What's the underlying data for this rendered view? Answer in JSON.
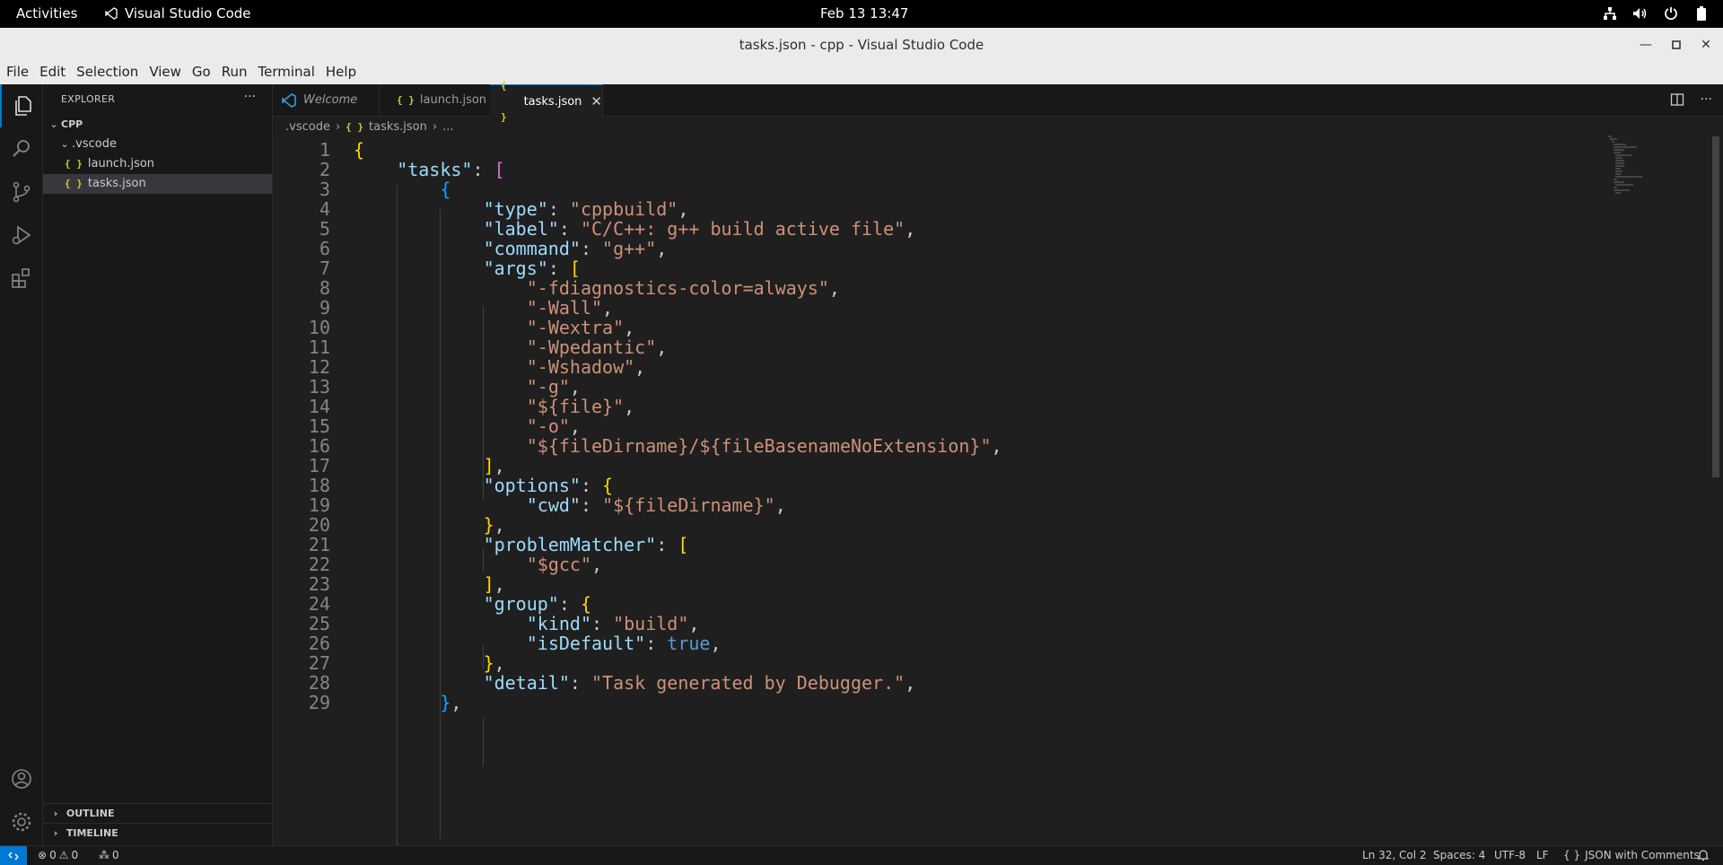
{
  "topbar": {
    "activities": "Activities",
    "app_name": "Visual Studio Code",
    "clock": "Feb 13  13:47"
  },
  "window": {
    "title": "tasks.json - cpp - Visual Studio Code"
  },
  "menu": [
    "File",
    "Edit",
    "Selection",
    "View",
    "Go",
    "Run",
    "Terminal",
    "Help"
  ],
  "sidebar": {
    "header": "EXPLORER",
    "root": "CPP",
    "folder": ".vscode",
    "files": [
      "launch.json",
      "tasks.json"
    ],
    "sections": [
      "OUTLINE",
      "TIMELINE"
    ]
  },
  "tabs": [
    {
      "label": "Welcome"
    },
    {
      "label": "launch.json"
    },
    {
      "label": "tasks.json"
    }
  ],
  "breadcrumb": [
    ".vscode",
    "tasks.json",
    "..."
  ],
  "editor": {
    "line_numbers": [
      "1",
      "2",
      "3",
      "4",
      "5",
      "6",
      "7",
      "8",
      "9",
      "10",
      "11",
      "12",
      "13",
      "14",
      "15",
      "16",
      "17",
      "18",
      "19",
      "20",
      "21",
      "22",
      "23",
      "24",
      "25",
      "26",
      "27",
      "28",
      "29"
    ],
    "lines": [
      "{",
      "    \"tasks\": [",
      "        {",
      "            \"type\": \"cppbuild\",",
      "            \"label\": \"C/C++: g++ build active file\",",
      "            \"command\": \"g++\",",
      "            \"args\": [",
      "                \"-fdiagnostics-color=always\",",
      "                \"-Wall\",",
      "                \"-Wextra\",",
      "                \"-Wpedantic\",",
      "                \"-Wshadow\",",
      "                \"-g\",",
      "                \"${file}\",",
      "                \"-o\",",
      "                \"${fileDirname}/${fileBasenameNoExtension}\",",
      "            ],",
      "            \"options\": {",
      "                \"cwd\": \"${fileDirname}\",",
      "            },",
      "            \"problemMatcher\": [",
      "                \"$gcc\",",
      "            ],",
      "            \"group\": {",
      "                \"kind\": \"build\",",
      "                \"isDefault\": true,",
      "            },",
      "            \"detail\": \"Task generated by Debugger.\",",
      "        },"
    ]
  },
  "statusbar": {
    "errors": "0",
    "warnings": "0",
    "ports": "0",
    "cursor": "Ln 32, Col 2",
    "spaces": "Spaces: 4",
    "encoding": "UTF-8",
    "eol": "LF",
    "language": "JSON with Comments"
  },
  "colors": {
    "accent": "#0078d4",
    "key": "#9cdcfe",
    "string": "#ce9178",
    "keyword": "#569cd6"
  },
  "icons": [
    "explorer-icon",
    "search-icon",
    "source-control-icon",
    "run-debug-icon",
    "extensions-icon",
    "account-icon",
    "settings-gear-icon",
    "split-editor-icon",
    "more-icon",
    "close-icon",
    "bell-icon"
  ]
}
